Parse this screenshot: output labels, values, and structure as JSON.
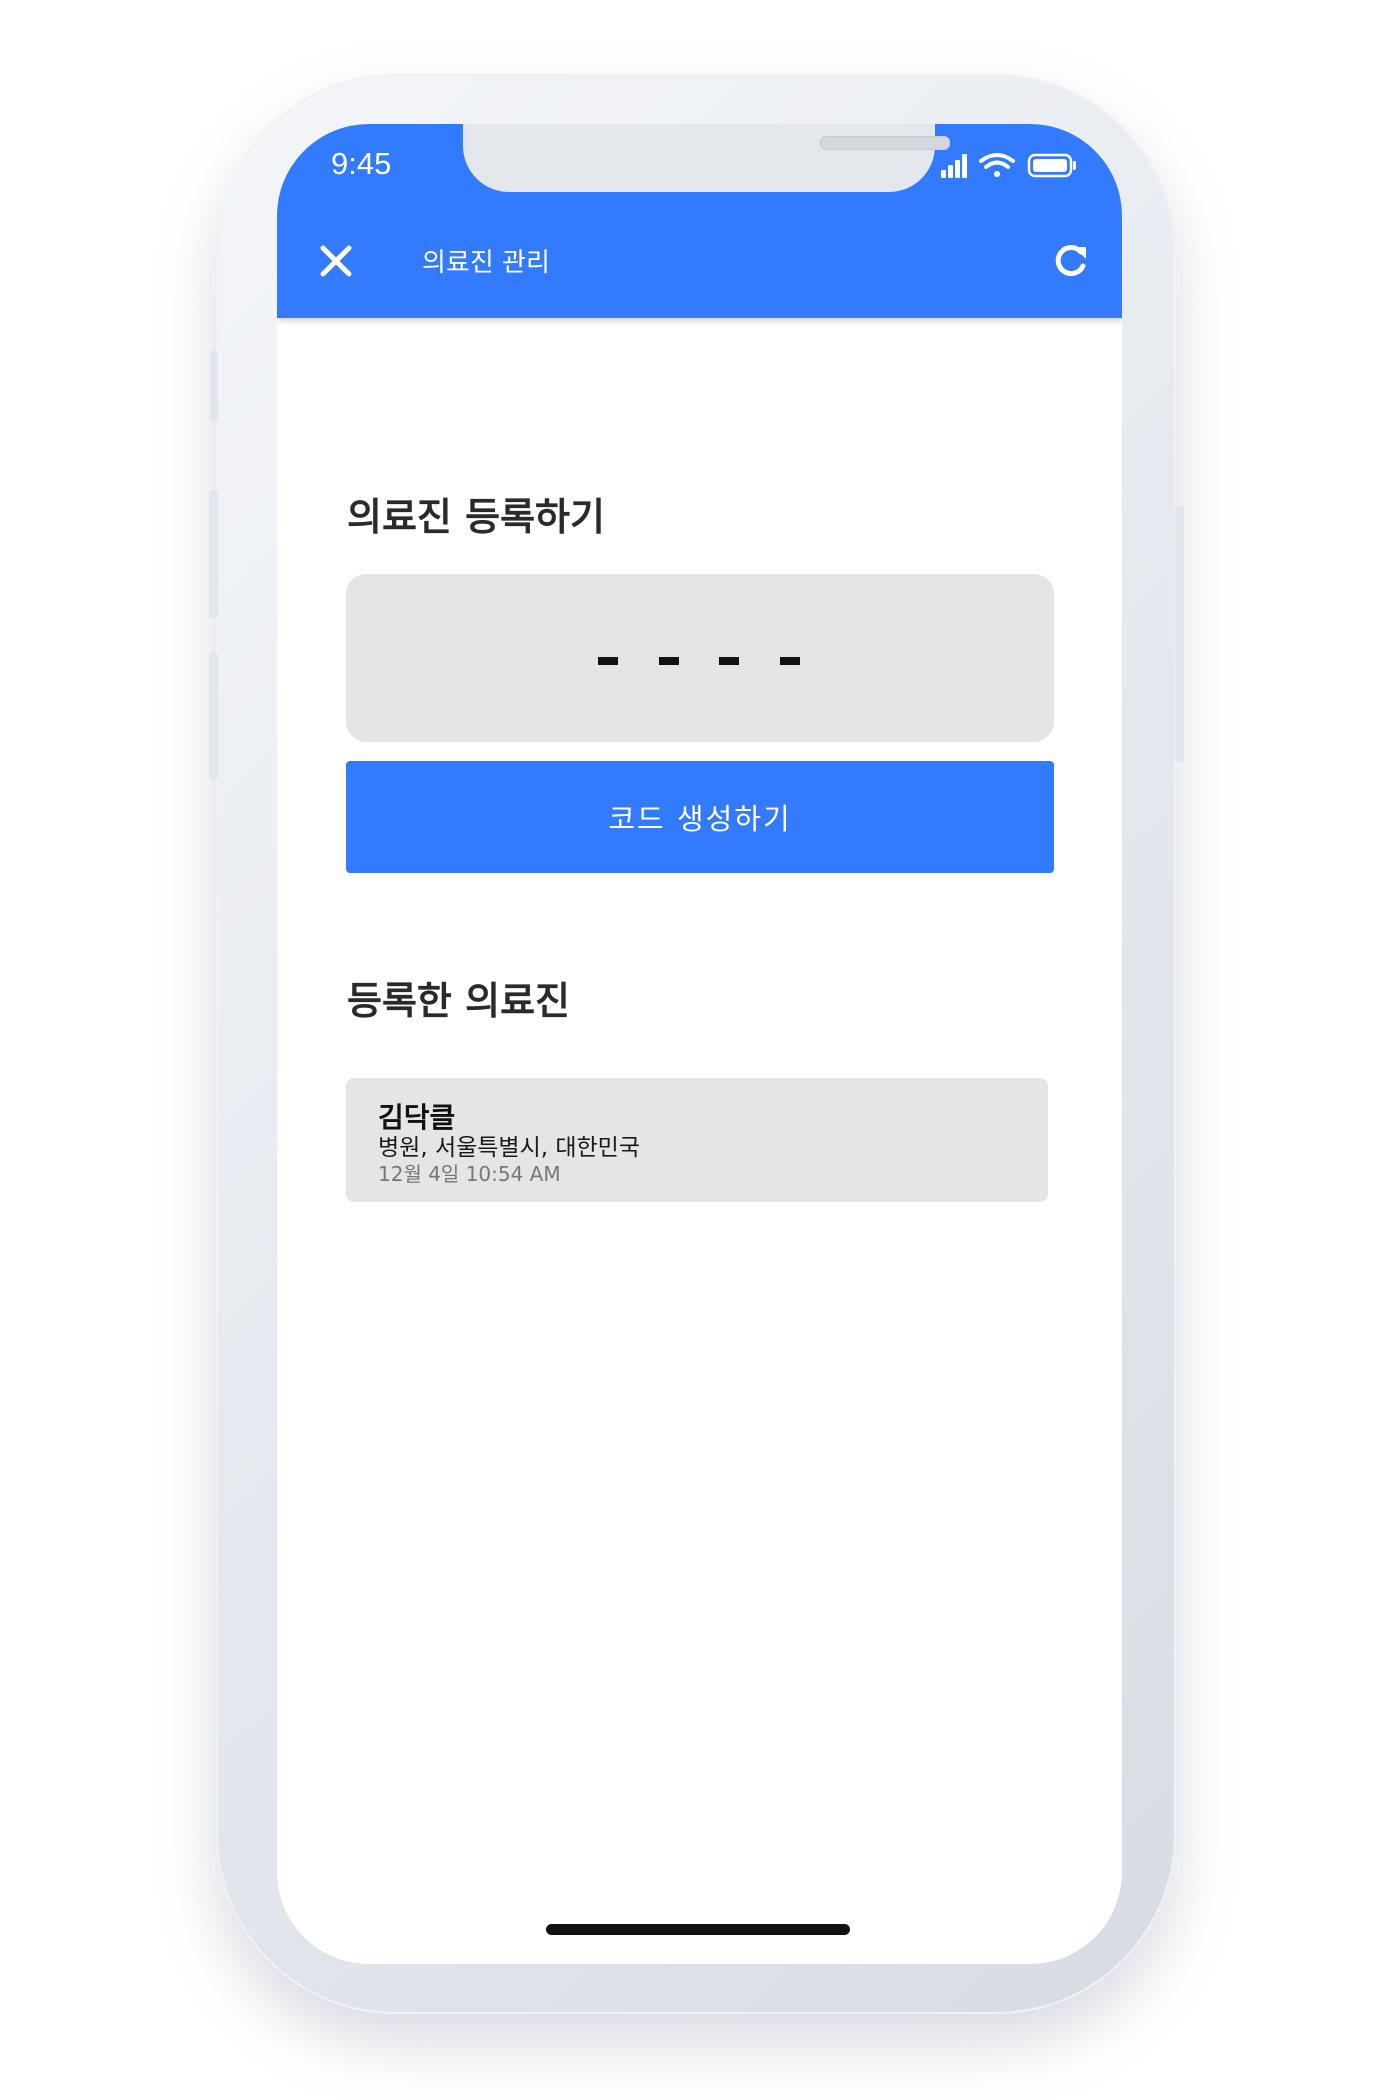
{
  "status_bar": {
    "time": "9:45",
    "icons": [
      "cellular-signal-icon",
      "wifi-icon",
      "battery-icon"
    ]
  },
  "header": {
    "close_icon": "close-icon",
    "title": "의료진 관리",
    "refresh_icon": "refresh-icon"
  },
  "register_section": {
    "title": "의료진 등록하기",
    "code_placeholder": "- - - -",
    "generate_button_label": "코드 생성하기"
  },
  "registered_section": {
    "title": "등록한 의료진",
    "doctors": [
      {
        "name": "김닥클",
        "location": "병원, 서울특별시, 대한민국",
        "registered_at": "12월 4일 10:54 AM"
      }
    ]
  },
  "colors": {
    "primary": "#327aff",
    "card_background": "#e5e5e5",
    "text_primary": "#2a2a2a",
    "text_secondary": "#777777"
  }
}
